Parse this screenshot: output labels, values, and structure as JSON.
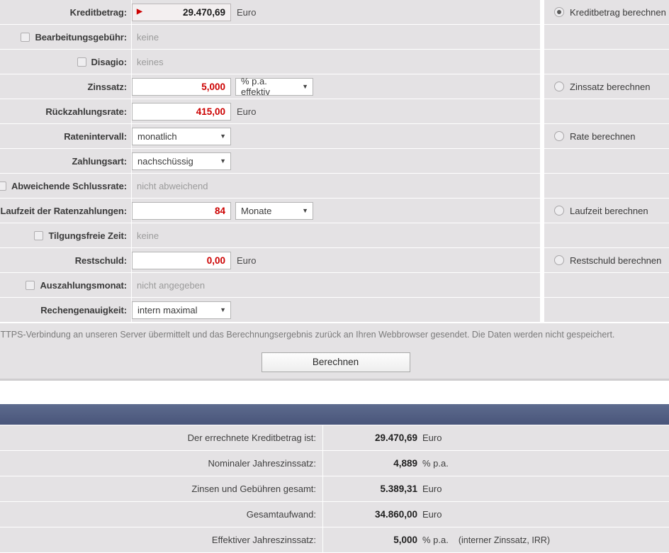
{
  "form": {
    "rows": [
      {
        "label": "Kreditbetrag:",
        "kind": "result-input",
        "value": "29.470,69",
        "unit": "Euro",
        "marker": "▶",
        "checkbox": false,
        "radio": {
          "label": "Kreditbetrag berechnen",
          "selected": true
        }
      },
      {
        "label": "Bearbeitungsgebühr:",
        "kind": "placeholder",
        "value": "keine",
        "checkbox": true,
        "checked": false,
        "radio": null
      },
      {
        "label": "Disagio:",
        "kind": "placeholder",
        "value": "keines",
        "checkbox": true,
        "checked": false,
        "radio": null
      },
      {
        "label": "Zinssatz:",
        "kind": "input-select",
        "value": "5,000",
        "select": "% p.a. effektiv",
        "checkbox": false,
        "radio": {
          "label": "Zinssatz berechnen",
          "selected": false
        }
      },
      {
        "label": "Rückzahlungsrate:",
        "kind": "input",
        "value": "415,00",
        "unit": "Euro",
        "checkbox": false,
        "radio": null
      },
      {
        "label": "Ratenintervall:",
        "kind": "select",
        "select": "monatlich",
        "checkbox": false,
        "radio": {
          "label": "Rate berechnen",
          "selected": false
        }
      },
      {
        "label": "Zahlungsart:",
        "kind": "select",
        "select": "nachschüssig",
        "checkbox": false,
        "radio": null
      },
      {
        "label": "Abweichende Schlussrate:",
        "kind": "placeholder",
        "value": "nicht abweichend",
        "checkbox": true,
        "checked": false,
        "radio": null
      },
      {
        "label": "Laufzeit der Ratenzahlungen:",
        "kind": "input-select",
        "value": "84",
        "select": "Monate",
        "checkbox": false,
        "radio": {
          "label": "Laufzeit berechnen",
          "selected": false
        }
      },
      {
        "label": "Tilgungsfreie Zeit:",
        "kind": "placeholder",
        "value": "keine",
        "checkbox": true,
        "checked": false,
        "radio": null
      },
      {
        "label": "Restschuld:",
        "kind": "input",
        "value": "0,00",
        "unit": "Euro",
        "checkbox": false,
        "radio": {
          "label": "Restschuld berechnen",
          "selected": false
        }
      },
      {
        "label": "Auszahlungsmonat:",
        "kind": "placeholder",
        "value": "nicht angegeben",
        "checkbox": true,
        "checked": false,
        "radio": null
      },
      {
        "label": "Rechengenauigkeit:",
        "kind": "select",
        "select": "intern maximal",
        "checkbox": false,
        "radio": null
      }
    ]
  },
  "info": {
    "text": "Bei der Berechnung werden Ihre Eingabedaten über eine sichere HTTPS-Verbindung an unseren Server übermittelt und das Berechnungsergebnis zurück an Ihren Webbrowser gesendet. Die Daten werden nicht gespeichert."
  },
  "actions": {
    "calculate_label": "Berechnen"
  },
  "results": {
    "header_title": "",
    "rows": [
      {
        "label": "Der errechnete Kreditbetrag ist:",
        "value": "29.470,69",
        "unit": "Euro",
        "note": ""
      },
      {
        "label": "Nominaler Jahreszinssatz:",
        "value": "4,889",
        "unit": "% p.a.",
        "note": ""
      },
      {
        "label": "Zinsen und Gebühren gesamt:",
        "value": "5.389,31",
        "unit": "Euro",
        "note": ""
      },
      {
        "label": "Gesamtaufwand:",
        "value": "34.860,00",
        "unit": "Euro",
        "note": ""
      },
      {
        "label": "Effektiver Jahreszinssatz:",
        "value": "5,000",
        "unit": "% p.a.",
        "note": "(interner Zinssatz, IRR)"
      }
    ]
  },
  "colors": {
    "input_text": "#cc0000",
    "row_bg": "#e4e2e4",
    "results_header": "#4f5c81",
    "placeholder": "#9b9b9b"
  }
}
